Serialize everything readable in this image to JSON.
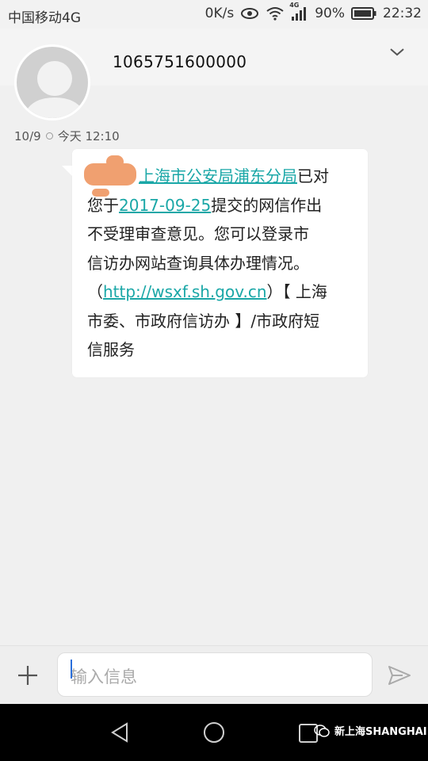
{
  "status_bar": {
    "carrier": "中国移动4G",
    "speed": "0K/s",
    "network_badge": "4G",
    "battery_percent": "90%",
    "time": "22:32"
  },
  "header": {
    "contact_number": "1065751600000"
  },
  "conversation": {
    "date": "10/9",
    "time": "今天 12:10",
    "message": {
      "part1": "上海市公安局浦东分局",
      "part2": "已对",
      "part3": "您于",
      "part4": "2017-09-25",
      "part5": "提交的网信作出",
      "line3": "不受理审查意见。您可以登录市",
      "line4": "信访办网站查询具体办理情况。",
      "paren_open": "（",
      "url": "http://wsxf.sh.gov.cn",
      "line5_tail": "）【 上海",
      "line6": "市委、市政府信访办 】/市政府短",
      "line7": "信服务"
    }
  },
  "input_bar": {
    "placeholder": "输入信息"
  },
  "watermark": {
    "text": "新上海SHANGHAI"
  },
  "colors": {
    "link": "#1aa7a7",
    "redaction": "#f0a070",
    "navbar": "#000000"
  }
}
